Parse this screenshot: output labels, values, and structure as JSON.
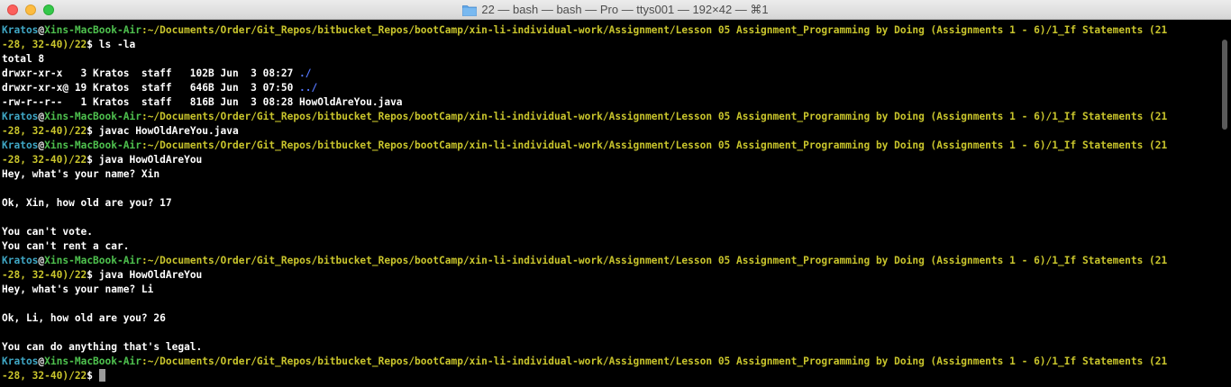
{
  "window": {
    "title": "22 — bash — bash — Pro — ttys001 — 192×42 — ⌘1",
    "folder_icon": "folder-icon"
  },
  "colors": {
    "user": "#3fa6c4",
    "host": "#4ec14e",
    "path": "#c9c52c",
    "dir": "#5577ff",
    "background": "#000000"
  },
  "prompt": {
    "user": "Kratos",
    "at": "@",
    "host": "Xins-MacBook-Air",
    "path_line1": ":~/Documents/Order/Git_Repos/bitbucket_Repos/bootCamp/xin-li-individual-work/Assignment/Lesson 05 Assignment_Programming by Doing (Assignments 1 - 6)/1_If Statements (21",
    "path_line2": "-28, 32-40)/22",
    "dollar": "$"
  },
  "terminal": {
    "cmd1": " ls -la",
    "ls_total": "total 8",
    "ls_row1": "drwxr-xr-x   3 Kratos  staff   102B Jun  3 08:27 ",
    "ls_row1_name": "./",
    "ls_row2": "drwxr-xr-x@ 19 Kratos  staff   646B Jun  3 07:50 ",
    "ls_row2_name": "../",
    "ls_row3": "-rw-r--r--   1 Kratos  staff   816B Jun  3 08:28 HowOldAreYou.java",
    "cmd2": " javac HowOldAreYou.java",
    "cmd3": " java HowOldAreYou",
    "run1": [
      "Hey, what's your name? Xin",
      "",
      "Ok, Xin, how old are you? 17",
      "",
      "You can't vote.",
      "You can't rent a car."
    ],
    "cmd4": " java HowOldAreYou",
    "run2": [
      "Hey, what's your name? Li",
      "",
      "Ok, Li, how old are you? 26",
      "",
      "You can do anything that's legal."
    ]
  }
}
